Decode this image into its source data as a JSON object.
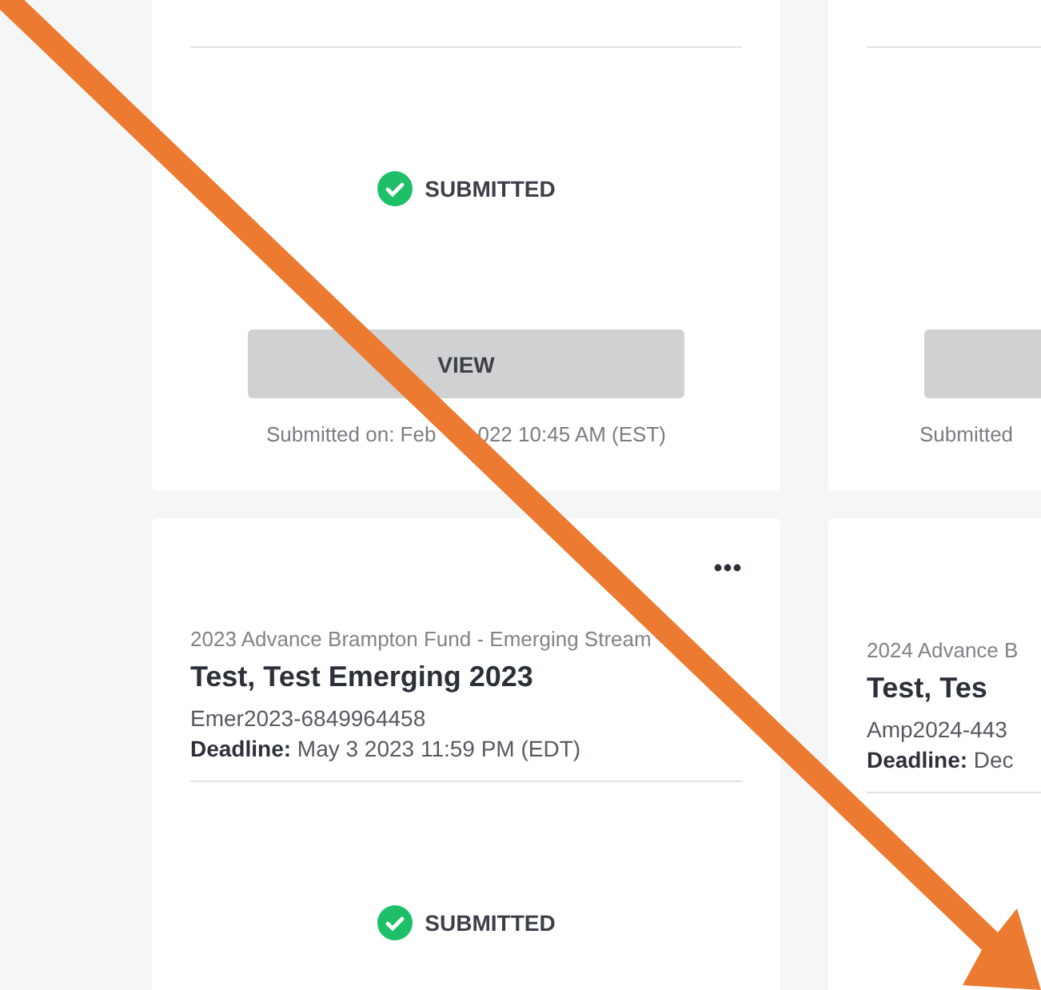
{
  "columns": [
    {
      "cards": [
        {
          "status": {
            "kind": "submitted",
            "label": "SUBMITTED"
          },
          "kind": "with_footer",
          "button": "VIEW",
          "submitted_on": [
            "Submitted on: Feb",
            "022 10:45 AM (EST)"
          ]
        },
        {
          "program": "2023 Advance Brampton Fund - Emerging Stream",
          "title": "Test, Test Emerging 2023",
          "id": "Emer2023-6849964458",
          "deadline_label": "Deadline:",
          "deadline": "May 3 2023 11:59 PM (EDT)",
          "status": {
            "kind": "submitted",
            "label": "SUBMITTED"
          }
        }
      ]
    },
    {
      "cards": [
        {
          "kind": "with_footer",
          "submitted_on": [
            "Submitted"
          ]
        },
        {
          "program": "2024 Advance B",
          "title": "Test, Tes",
          "id": "Amp2024-443",
          "deadline_label": "Deadline:",
          "deadline": "Dec"
        }
      ]
    }
  ]
}
